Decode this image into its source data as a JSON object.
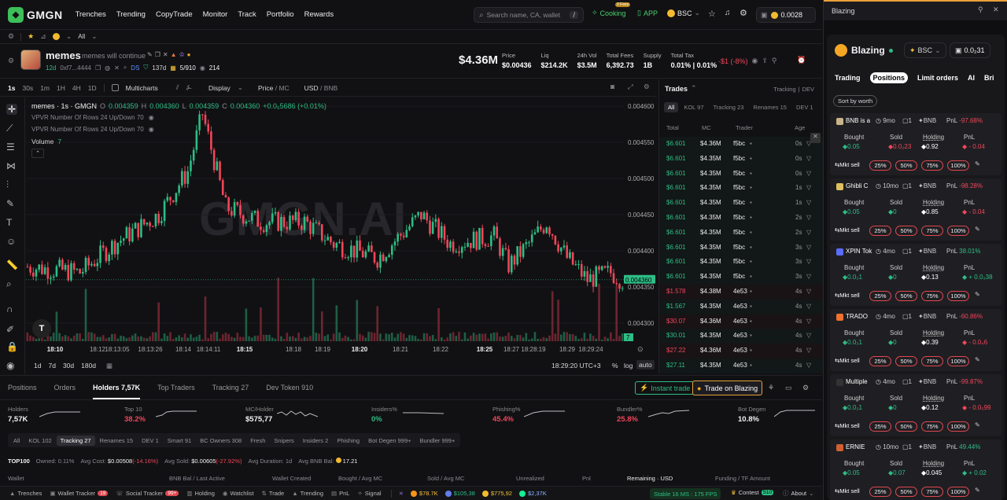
{
  "nav": {
    "logo": "GMGN",
    "items": [
      "Trenches",
      "Trending",
      "CopyTrade",
      "Monitor",
      "Track",
      "Portfolio",
      "Rewards"
    ],
    "search_placeholder": "Search name, CA, wallet",
    "search_key": "/",
    "cooking": "Cooking",
    "cooking_badge": "0 Fees",
    "app": "APP",
    "chain": "BSC",
    "balance": "0.0028"
  },
  "subbar": {
    "all": "All"
  },
  "token": {
    "name": "memes",
    "desc": "memes will continue",
    "age": "12d",
    "ca": "0xf7...4444",
    "ds": "DS",
    "days": "137d",
    "holders_ratio": "5/910",
    "views": "214",
    "mcap": "$4.36M",
    "stats": [
      {
        "label": "Price",
        "value": "$0.00436"
      },
      {
        "label": "Liq",
        "value": "$214.2K"
      },
      {
        "label": "24h Vol",
        "value": "$3.5M"
      },
      {
        "label": "Total Fees",
        "value": "6,392.73"
      },
      {
        "label": "Supply",
        "value": "1B"
      },
      {
        "label": "Total Tax",
        "value": "0.01% | 0.01%"
      }
    ],
    "pnl": "-$1 (-8%)"
  },
  "chart": {
    "intervals": [
      "1s",
      "30s",
      "1m",
      "1H",
      "4H",
      "1D"
    ],
    "multicharts": "Multicharts",
    "display": "Display",
    "price_mc": "Price",
    "mc": "MC",
    "usd": "USD",
    "bnb": "BNB",
    "legend_title": "memes · 1s · GMGN",
    "o": "0.004359",
    "h": "0.004360",
    "l": "0.004359",
    "c": "0.004360",
    "chg": "+0.0₆5686 (+0.01%)",
    "vpvr1": "VPVR Number Of Rows 24 Up/Down 70",
    "vpvr2": "VPVR Number Of Rows 24 Up/Down 70",
    "volume_label": "Volume",
    "volume_val": "7",
    "watermark": "GMGN.AI",
    "price_ticks": [
      "0.004600",
      "0.004550",
      "0.004500",
      "0.004450",
      "0.004400",
      "0.004350",
      "0.004300"
    ],
    "last_price": "0.004360",
    "vol_last": "7",
    "time_ticks": [
      "18:10",
      "18:12",
      "18:13:05",
      "18:13:26",
      "18:14",
      "18:14:11",
      "18:15",
      "18:18",
      "18:19",
      "18:20",
      "18:21",
      "18:22",
      "18:25",
      "18:27",
      "18:28:19",
      "18:29",
      "18:29:24"
    ],
    "ranges": [
      "1d",
      "7d",
      "30d",
      "180d"
    ],
    "clock": "18:29:20 UTC+3",
    "pct": "%",
    "log": "log",
    "auto": "auto"
  },
  "trades": {
    "title": "Trades",
    "tracking": "Tracking",
    "dev": "DEV",
    "tabs": [
      "All",
      "KOL 97",
      "Tracking 23",
      "Renames 15",
      "DEV 1"
    ],
    "cols": [
      "Total",
      "MC",
      "Trader",
      "Age"
    ],
    "rows": [
      {
        "t": "$6.601",
        "mc": "$4.36M",
        "tr": "f5bc",
        "age": "0s",
        "s": "b"
      },
      {
        "t": "$6.601",
        "mc": "$4.35M",
        "tr": "f5bc",
        "age": "0s",
        "s": "b"
      },
      {
        "t": "$6.601",
        "mc": "$4.35M",
        "tr": "f5bc",
        "age": "0s",
        "s": "b"
      },
      {
        "t": "$6.601",
        "mc": "$4.35M",
        "tr": "f5bc",
        "age": "1s",
        "s": "b"
      },
      {
        "t": "$6.601",
        "mc": "$4.35M",
        "tr": "f5bc",
        "age": "1s",
        "s": "b"
      },
      {
        "t": "$6.601",
        "mc": "$4.35M",
        "tr": "f5bc",
        "age": "2s",
        "s": "b"
      },
      {
        "t": "$6.601",
        "mc": "$4.35M",
        "tr": "f5bc",
        "age": "2s",
        "s": "b"
      },
      {
        "t": "$6.601",
        "mc": "$4.35M",
        "tr": "f5bc",
        "age": "3s",
        "s": "b"
      },
      {
        "t": "$6.601",
        "mc": "$4.35M",
        "tr": "f5bc",
        "age": "3s",
        "s": "b"
      },
      {
        "t": "$6.601",
        "mc": "$4.35M",
        "tr": "f5bc",
        "age": "3s",
        "s": "b"
      },
      {
        "t": "$1.578",
        "mc": "$4.38M",
        "tr": "4e53",
        "age": "4s",
        "s": "s"
      },
      {
        "t": "$1.567",
        "mc": "$4.35M",
        "tr": "4e53",
        "age": "4s",
        "s": "b"
      },
      {
        "t": "$30.07",
        "mc": "$4.36M",
        "tr": "4e53",
        "age": "4s",
        "s": "s"
      },
      {
        "t": "$30.01",
        "mc": "$4.35M",
        "tr": "4e53",
        "age": "4s",
        "s": "b"
      },
      {
        "t": "$27.22",
        "mc": "$4.36M",
        "tr": "4e53",
        "age": "4s",
        "s": "s"
      },
      {
        "t": "$27.11",
        "mc": "$4.35M",
        "tr": "4e53",
        "age": "4s",
        "s": "b"
      }
    ]
  },
  "bottom": {
    "tabs": [
      "Positions",
      "Orders",
      "Holders 7,57K",
      "Top Traders",
      "Tracking 27",
      "Dev Token 910"
    ],
    "instant": "Instant trade",
    "blazing": "Trade on Blazing",
    "metrics": [
      {
        "label": "Holders",
        "value": "7,57K",
        "c": "w"
      },
      {
        "label": "Top 10",
        "value": "38.2%",
        "c": "r"
      },
      {
        "label": "MC/Holder",
        "value": "$575,77",
        "c": "w"
      },
      {
        "label": "Insiders%",
        "value": "0%",
        "c": "g"
      },
      {
        "label": "Phishing%",
        "value": "45.4%",
        "c": "r"
      },
      {
        "label": "Bundler%",
        "value": "25.8%",
        "c": "r"
      },
      {
        "label": "Bot Degen",
        "value": "10.8%",
        "c": "w"
      }
    ],
    "filters": [
      "All",
      "KOL 102",
      "Tracking 27",
      "Renames 15",
      "DEV 1",
      "Smart 91",
      "BC Owners 308",
      "Fresh",
      "Snipers",
      "Insiders 2",
      "Phishing",
      "Bot Degen 999+",
      "Bundler 999+"
    ],
    "top100": "TOP100",
    "owned": "Owned: 0.11%",
    "avg_cost_l": "Avg Cost:",
    "avg_cost": "$0.00508",
    "avg_cost_p": "(-14.16%)",
    "avg_sold_l": "Avg Sold:",
    "avg_sold": "$0.00605",
    "avg_sold_p": "(-27.92%)",
    "avg_dur": "Avg Duration: 1d",
    "avg_bnb": "Avg BNB Bal: ",
    "avg_bnb_v": "17.21",
    "cols": [
      "Wallet",
      "BNB Bal / Last Active",
      "Wallet Created",
      "Bought / Avg MC",
      "Sold / Avg MC",
      "Unrealized",
      "Pnl",
      "Remaining · USD",
      "Funding / TF Amount"
    ]
  },
  "footer": {
    "items": [
      "Trenches",
      "Wallet Tracker",
      "Social Tracker",
      "Holding",
      "Watchlist",
      "Trade",
      "Trending",
      "PnL",
      "Signal"
    ],
    "wt_badge": "19",
    "st_badge": "99+",
    "btc": "$78.7K",
    "eth": "$105,38",
    "bnb": "$775,92",
    "sol": "$2,37K",
    "stable": "Stable 16 MS : 175 FPS",
    "contest": "Contest",
    "contest_badge": "S10",
    "about": "About"
  },
  "right": {
    "title": "Blazing",
    "brand": "Blazing",
    "chain": "BSC",
    "balance": "0.0₂31",
    "tabs": [
      "Trading",
      "Positions",
      "Limit orders",
      "AI",
      "Bri"
    ],
    "sort": "Sort by worth",
    "mkt": "Mkt sell",
    "sells": [
      "25%",
      "50%",
      "75%",
      "100%"
    ],
    "cards": [
      {
        "name": "BNB is a",
        "age": "9mo",
        "n": "1",
        "chain": "BNB",
        "pnl": "-97.68%",
        "bought": "0.05",
        "sold": "0.0₂23",
        "holding": "0.92",
        "pl": "- 0.04",
        "pc": "r",
        "sc": "r"
      },
      {
        "name": "Ghibli C",
        "age": "10mo",
        "n": "1",
        "chain": "BNB",
        "pnl": "-98.28%",
        "bought": "0.05",
        "sold": "0",
        "holding": "0.85",
        "pl": "- 0.04",
        "pc": "r",
        "sc": "g"
      },
      {
        "name": "XPIN Tok",
        "age": "4mo",
        "n": "1",
        "chain": "BNB",
        "pnl": "38.01%",
        "bought": "0.0₃1",
        "sold": "0",
        "holding": "0.13",
        "pl": "+ 0.0₃38",
        "pc": "g",
        "sc": "g"
      },
      {
        "name": "TRADO",
        "age": "4mo",
        "n": "1",
        "chain": "BNB",
        "pnl": "-60.86%",
        "bought": "0.0₃1",
        "sold": "0",
        "holding": "0.39",
        "pl": "- 0.0₄6",
        "pc": "r",
        "sc": "g"
      },
      {
        "name": "Multiple",
        "age": "4mo",
        "n": "1",
        "chain": "BNB",
        "pnl": "-99.87%",
        "bought": "0.0₃1",
        "sold": "0",
        "holding": "0.12",
        "pl": "- 0.0₅99",
        "pc": "r",
        "sc": "g"
      },
      {
        "name": "ERNIE",
        "age": "10mo",
        "n": "1",
        "chain": "BNB",
        "pnl": "49.44%",
        "bought": "0.05",
        "sold": "0.07",
        "holding": "0.045",
        "pl": "+ 0.02",
        "pc": "g",
        "sc": "g"
      }
    ],
    "labels": {
      "bought": "Bought",
      "sold": "Sold",
      "holding": "Holding",
      "pnl": "PnL"
    }
  }
}
